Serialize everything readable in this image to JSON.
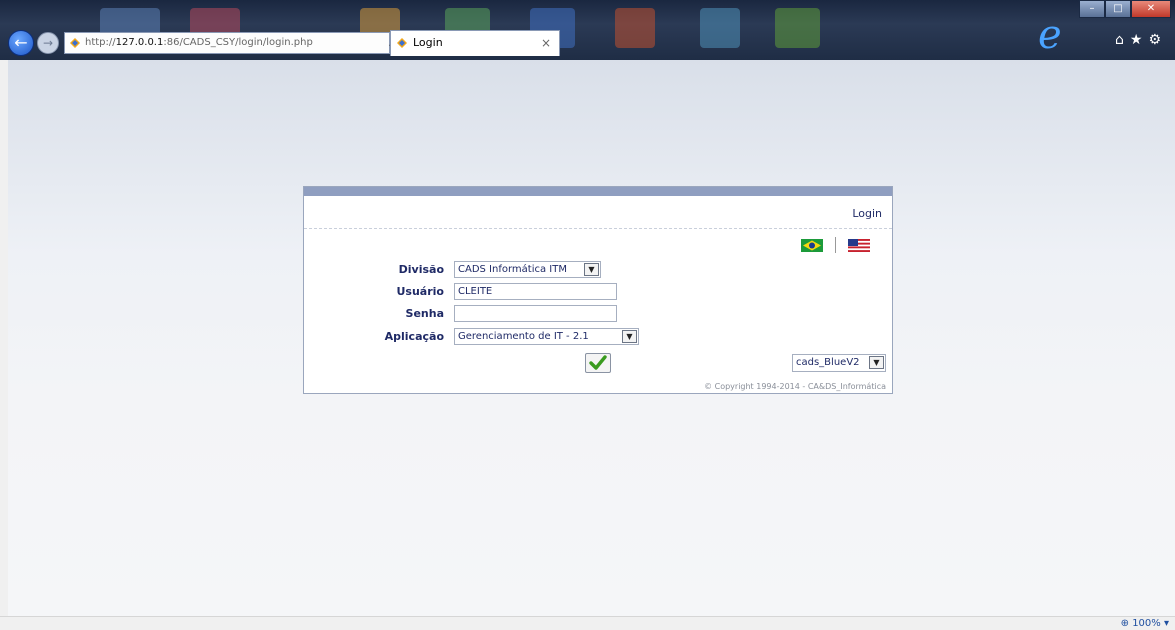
{
  "browser": {
    "address_prefix": "http://",
    "address_host": "127.0.0.1",
    "address_rest": ":86/CADS_CSY/login/login.php",
    "tab_title": "Login",
    "tab_close": "×",
    "zoom": "⊕ 100%  ▾"
  },
  "login": {
    "title": "Login",
    "fields": {
      "divisao_label": "Divisão",
      "divisao_value": "CADS Informática ITM",
      "usuario_label": "Usuário",
      "usuario_value": "CLEITE",
      "senha_label": "Senha",
      "senha_value": "",
      "aplicacao_label": "Aplicação",
      "aplicacao_value": "Gerenciamento de IT - 2.1"
    },
    "theme_value": "cads_BlueV2",
    "copyright": "© Copyright 1994-2014 - CA&DS_Informática"
  },
  "icons": {
    "back": "back-arrow-icon",
    "forward": "forward-arrow-icon",
    "submit": "checkmark-icon",
    "flag_br": "brazil-flag-icon",
    "flag_us": "usa-flag-icon"
  },
  "colors": {
    "label": "#1f2a66",
    "header_bar": "#8f9ec0",
    "check": "#3a9b1f"
  }
}
